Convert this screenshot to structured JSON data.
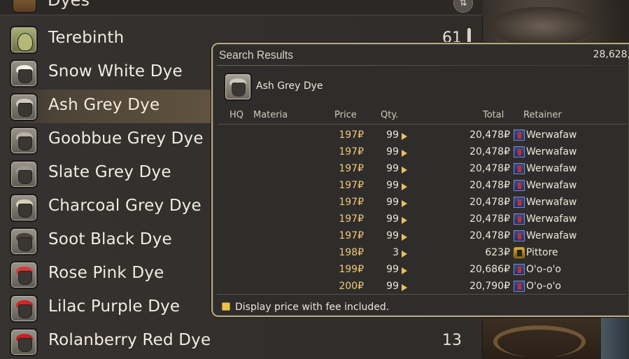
{
  "list": {
    "category": "Dyes",
    "items": [
      {
        "name": "Terebinth",
        "count": "61",
        "icon": "bottle-icon",
        "liquid": ""
      },
      {
        "name": "Snow White Dye",
        "count": "",
        "icon": "dye-pot-icon",
        "liquid": "#f2efe6"
      },
      {
        "name": "Ash Grey Dye",
        "count": "",
        "icon": "dye-pot-icon",
        "liquid": "#cfcabc"
      },
      {
        "name": "Goobbue Grey Dye",
        "count": "",
        "icon": "dye-pot-icon",
        "liquid": "#bab2a2"
      },
      {
        "name": "Slate Grey Dye",
        "count": "",
        "icon": "dye-pot-icon",
        "liquid": "#9c9890"
      },
      {
        "name": "Charcoal Grey Dye",
        "count": "",
        "icon": "dye-pot-icon",
        "liquid": "#d8d0b8"
      },
      {
        "name": "Soot Black Dye",
        "count": "",
        "icon": "dye-pot-icon",
        "liquid": "#4a4438"
      },
      {
        "name": "Rose Pink Dye",
        "count": "",
        "icon": "dye-pot-icon",
        "liquid": "#d83838"
      },
      {
        "name": "Lilac Purple Dye",
        "count": "",
        "icon": "dye-pot-icon",
        "liquid": "#d02828"
      },
      {
        "name": "Rolanberry Red Dye",
        "count": "13",
        "icon": "dye-pot-icon",
        "liquid": "#c82020"
      }
    ],
    "selected_index": 2
  },
  "results": {
    "title": "Search Results",
    "gil": "28,628,",
    "item_name": "Ash Grey Dye",
    "columns": {
      "hq": "HQ",
      "materia": "Materia",
      "price": "Price",
      "qty": "Qty.",
      "total": "Total",
      "retainer": "Retainer"
    },
    "rows": [
      {
        "price": "197₽",
        "qty": "99",
        "total": "20,478₽",
        "retainer": "Werwafaw",
        "icon": "retainer-blue"
      },
      {
        "price": "197₽",
        "qty": "99",
        "total": "20,478₽",
        "retainer": "Werwafaw",
        "icon": "retainer-blue"
      },
      {
        "price": "197₽",
        "qty": "99",
        "total": "20,478₽",
        "retainer": "Werwafaw",
        "icon": "retainer-blue"
      },
      {
        "price": "197₽",
        "qty": "99",
        "total": "20,478₽",
        "retainer": "Werwafaw",
        "icon": "retainer-blue"
      },
      {
        "price": "197₽",
        "qty": "99",
        "total": "20,478₽",
        "retainer": "Werwafaw",
        "icon": "retainer-blue"
      },
      {
        "price": "197₽",
        "qty": "99",
        "total": "20,478₽",
        "retainer": "Werwafaw",
        "icon": "retainer-blue"
      },
      {
        "price": "197₽",
        "qty": "99",
        "total": "20,478₽",
        "retainer": "Werwafaw",
        "icon": "retainer-blue"
      },
      {
        "price": "198₽",
        "qty": "3",
        "total": "623₽",
        "retainer": "Pittore",
        "icon": "retainer-gold"
      },
      {
        "price": "199₽",
        "qty": "99",
        "total": "20,686₽",
        "retainer": "O'o-o'o",
        "icon": "retainer-blue"
      },
      {
        "price": "200₽",
        "qty": "99",
        "total": "20,790₽",
        "retainer": "O'o-o'o",
        "icon": "retainer-blue"
      }
    ],
    "fee_label": "Display price with fee included.",
    "fee_checked": true
  },
  "sort_icon": "sort-arrows-icon"
}
